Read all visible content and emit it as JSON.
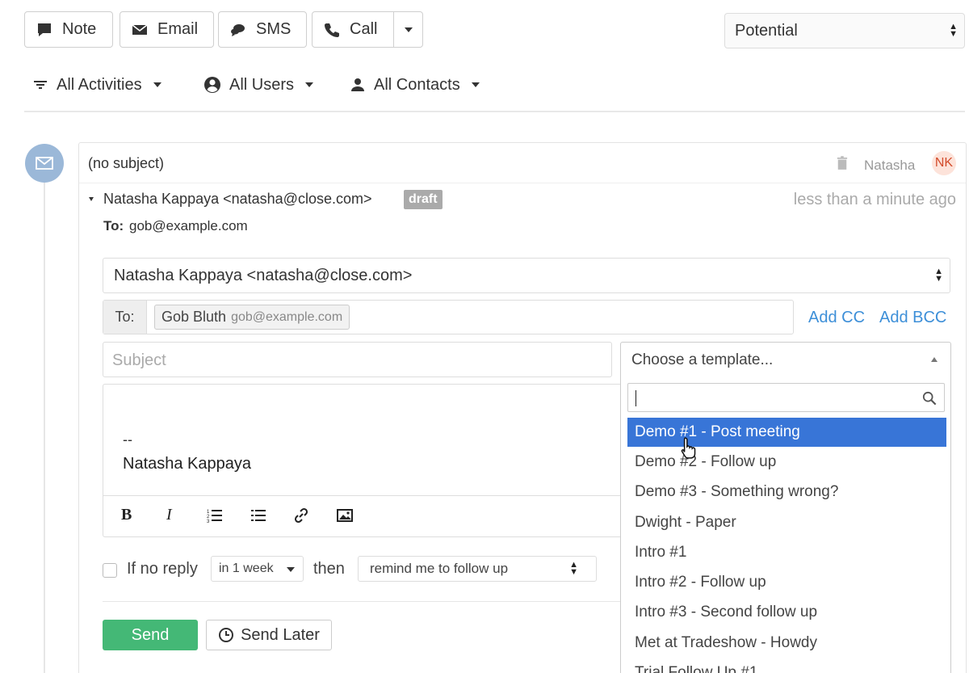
{
  "toolbar": {
    "note": "Note",
    "email": "Email",
    "sms": "SMS",
    "call": "Call",
    "status_select": "Potential"
  },
  "filters": {
    "activities": "All Activities",
    "users": "All Users",
    "contacts": "All Contacts"
  },
  "activity": {
    "subject": "(no subject)",
    "author_name": "Natasha",
    "author_initials": "NK",
    "from": "Natasha Kappaya <natasha@close.com>",
    "badge": "draft",
    "time": "less than a minute ago",
    "to_label": "To:",
    "to_address": "gob@example.com"
  },
  "compose": {
    "from_select": "Natasha Kappaya <natasha@close.com>",
    "to_label": "To:",
    "recipient_name": "Gob Bluth",
    "recipient_email": "gob@example.com",
    "add_cc": "Add CC",
    "add_bcc": "Add BCC",
    "subject_placeholder": "Subject",
    "template_placeholder": "Choose a template...",
    "signature_dash": "--",
    "signature_name": "Natasha Kappaya",
    "if_no_reply": "If no reply",
    "delay_select": "in 1 week",
    "then": "then",
    "action_select": "remind me to follow up",
    "send": "Send",
    "send_later": "Send Later"
  },
  "templates": [
    "Demo #1 - Post meeting",
    "Demo #2 - Follow up",
    "Demo #3 - Something wrong?",
    "Dwight - Paper",
    "Intro #1",
    "Intro #2 - Follow up",
    "Intro #3 - Second follow up",
    "Met at Tradeshow - Howdy",
    "Trial Follow Up #1"
  ],
  "colors": {
    "accent_blue": "#3875d7",
    "send_green": "#44b876",
    "link_blue": "#3d8fd8",
    "avatar_bg": "#fde3da",
    "avatar_text": "#d24b2b"
  }
}
